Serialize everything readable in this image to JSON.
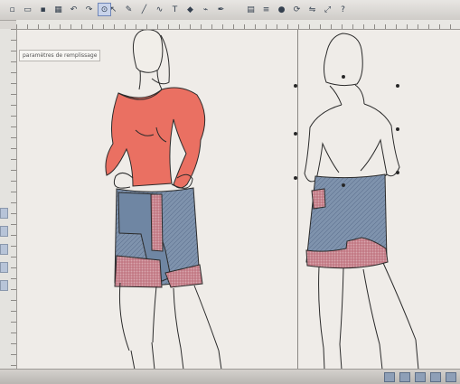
{
  "canvas": {
    "parameter_label": "paramètres de remplissage"
  },
  "icons": {
    "toolbar_left": [
      "new-file-icon",
      "open-icon",
      "save-icon",
      "print-icon",
      "undo-icon",
      "redo-icon",
      "zoom-icon"
    ],
    "toolbar_mid": [
      "pointer-icon",
      "pencil-icon",
      "line-icon",
      "curve-icon",
      "text-icon",
      "fill-icon",
      "eyedropper-icon",
      "pen-icon"
    ],
    "toolbar_right": [
      "grid-icon",
      "layers-icon",
      "color-icon",
      "rotate-icon",
      "mirror-icon",
      "scale-icon",
      "help-icon"
    ]
  },
  "colors": {
    "sweater": "#ea7062",
    "denim": "#7f93ad",
    "plaid": "#d8a6ad",
    "canvas": "#efece8",
    "outline": "#2b2b2b"
  }
}
